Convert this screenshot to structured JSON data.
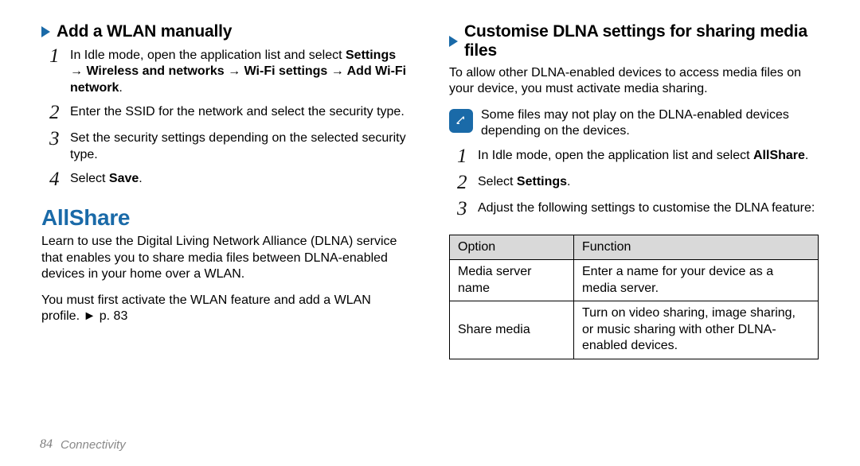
{
  "left": {
    "heading1": "Add a WLAN manually",
    "steps1": {
      "s1": {
        "num": "1",
        "a": "In Idle mode, open the application list and select ",
        "b": "Settings → Wireless and networks → Wi-Fi settings → Add Wi-Fi network",
        "c": "."
      },
      "s2": {
        "num": "2",
        "a": "Enter the SSID for the network and select the security type."
      },
      "s3": {
        "num": "3",
        "a": "Set the security settings depending on the selected security type."
      },
      "s4": {
        "num": "4",
        "a": "Select ",
        "b": "Save",
        "c": "."
      }
    },
    "sectionTitle": "AllShare",
    "p1": "Learn to use the Digital Living Network Alliance (DLNA) service that enables you to share media files between DLNA-enabled devices in your home over a WLAN.",
    "p2": "You must first activate the WLAN feature and add a WLAN profile. ► p. 83"
  },
  "right": {
    "heading1": "Customise DLNA settings for sharing media files",
    "p1": "To allow other DLNA-enabled devices to access media files on your device, you must activate media sharing.",
    "note": "Some files may not play on the DLNA-enabled devices depending on the devices.",
    "steps1": {
      "s1": {
        "num": "1",
        "a": "In Idle mode, open the application list and select ",
        "b": "AllShare",
        "c": "."
      },
      "s2": {
        "num": "2",
        "a": "Select ",
        "b": "Settings",
        "c": "."
      },
      "s3": {
        "num": "3",
        "a": "Adjust the following settings to customise the DLNA feature:"
      }
    },
    "table": {
      "h1": "Option",
      "h2": "Function",
      "r1c1": "Media server name",
      "r1c2": "Enter a name for your device as a media server.",
      "r2c1": "Share media",
      "r2c2": "Turn on video sharing, image sharing, or music sharing with other DLNA-enabled devices."
    }
  },
  "footer": {
    "page": "84",
    "section": "Connectivity"
  }
}
